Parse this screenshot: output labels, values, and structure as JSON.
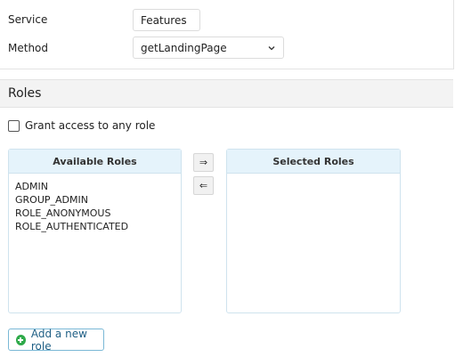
{
  "form": {
    "service_label": "Service",
    "service_value": "Features",
    "method_label": "Method",
    "method_value": "getLandingPage"
  },
  "roles": {
    "section_title": "Roles",
    "grant_label": "Grant access to any role",
    "available_title": "Available Roles",
    "selected_title": "Selected Roles",
    "available": [
      "ADMIN",
      "GROUP_ADMIN",
      "ROLE_ANONYMOUS",
      "ROLE_AUTHENTICATED"
    ],
    "selected": [],
    "move_right": "⇒",
    "move_left": "⇐",
    "add_button": "Add a new role"
  },
  "icons": {
    "dropdown": "chevron-down-icon",
    "add": "plus-circle-icon"
  },
  "colors": {
    "list_header_bg": "#e5f3fb",
    "add_icon": "#2faa4a",
    "add_button_border": "#7ab8d6"
  }
}
